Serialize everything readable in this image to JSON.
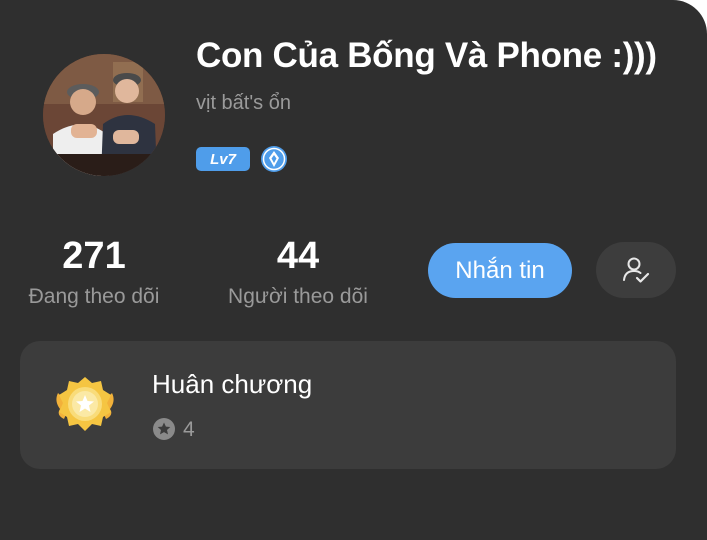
{
  "profile": {
    "display_name": "Con Của Bống Và Phone :)))",
    "username": "vịt bất's ổn",
    "level_badge": "Lv7",
    "verified_icon": "blue-verified-badge-icon"
  },
  "stats": {
    "following_count": "271",
    "following_label": "Đang theo dõi",
    "followers_count": "44",
    "followers_label": "Người theo dõi"
  },
  "actions": {
    "message_label": "Nhắn tin",
    "follow_icon": "user-check-icon"
  },
  "medals": {
    "title": "Huân chương",
    "count": "4",
    "icon": "medal-icon",
    "count_icon": "star-circle-icon"
  },
  "colors": {
    "background": "#2f2f2f",
    "card": "#3c3c3c",
    "accent": "#5aa4f0",
    "muted_text": "#9a9a9a"
  }
}
